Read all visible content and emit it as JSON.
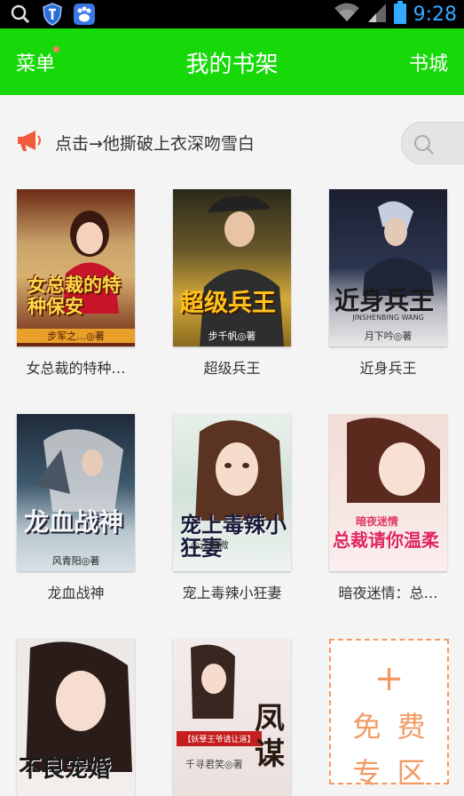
{
  "status_bar": {
    "time": "9:28",
    "icons": [
      "search-icon",
      "shield-icon",
      "paw-icon",
      "wifi-icon",
      "signal-icon",
      "battery-icon"
    ]
  },
  "header": {
    "menu_label": "菜单",
    "title": "我的书架",
    "store_label": "书城",
    "bg_color": "#17d90a"
  },
  "notice": {
    "text": "点击→他撕破上衣深吻雪白",
    "icon": "megaphone-icon"
  },
  "books": [
    {
      "title": "女总裁的特种…",
      "cover_title": "女总裁的特种保安",
      "cover_author": "步军之…◎著"
    },
    {
      "title": "超级兵王",
      "cover_title": "超级兵王",
      "cover_author": "步千帆◎著"
    },
    {
      "title": "近身兵王",
      "cover_title": "近身兵王",
      "cover_subtitle": "JINSHENBING WANG",
      "cover_author": "月下吟◎著"
    },
    {
      "title": "龙血战神",
      "cover_title": "龙血战神",
      "cover_author": "风青阳◎著"
    },
    {
      "title": "宠上毒辣小狂妻",
      "cover_title": "宠上毒辣小狂妻",
      "cover_author": "◎云维微"
    },
    {
      "title": "暗夜迷情：总…",
      "cover_title": "总裁请你温柔",
      "cover_subtitle": "暗夜迷情"
    },
    {
      "title": "",
      "cover_title": "不良宠婚"
    },
    {
      "title": "",
      "cover_title": "凤谋",
      "cover_subtitle": "【妖孽王爷请让道】",
      "cover_author": "千寻君笑◎著"
    }
  ],
  "free_zone": {
    "plus": "+",
    "line1": "免费",
    "line2": "专区"
  }
}
